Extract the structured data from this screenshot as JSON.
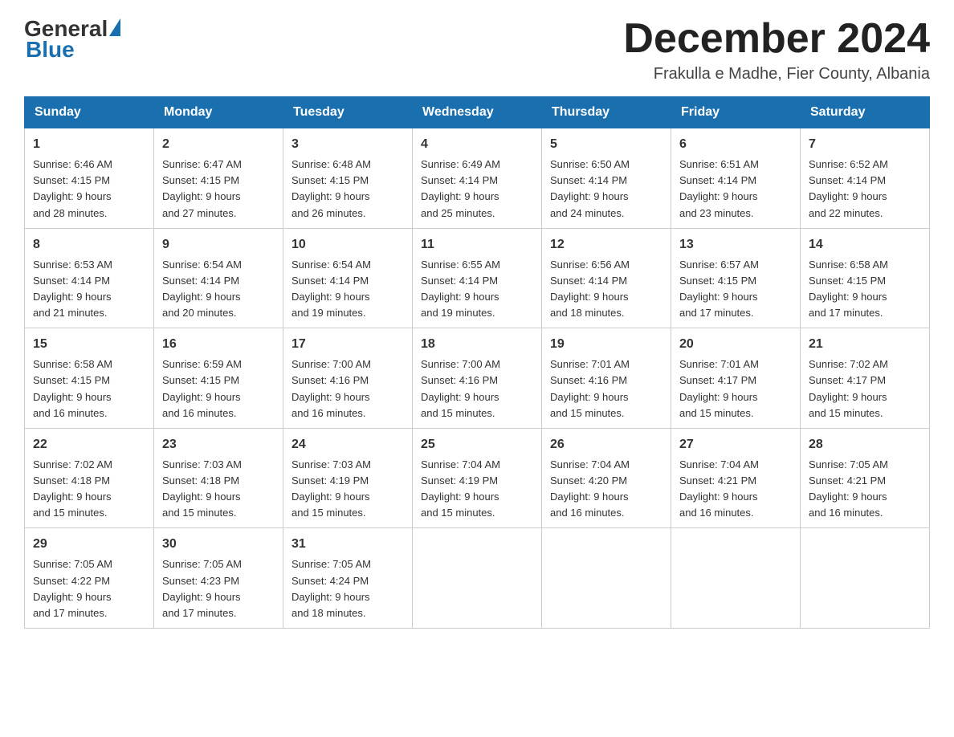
{
  "header": {
    "logo": {
      "general": "General",
      "blue": "Blue"
    },
    "title": "December 2024",
    "location": "Frakulla e Madhe, Fier County, Albania"
  },
  "days_of_week": [
    "Sunday",
    "Monday",
    "Tuesday",
    "Wednesday",
    "Thursday",
    "Friday",
    "Saturday"
  ],
  "weeks": [
    [
      {
        "day": "1",
        "sunrise": "6:46 AM",
        "sunset": "4:15 PM",
        "daylight": "9 hours and 28 minutes."
      },
      {
        "day": "2",
        "sunrise": "6:47 AM",
        "sunset": "4:15 PM",
        "daylight": "9 hours and 27 minutes."
      },
      {
        "day": "3",
        "sunrise": "6:48 AM",
        "sunset": "4:15 PM",
        "daylight": "9 hours and 26 minutes."
      },
      {
        "day": "4",
        "sunrise": "6:49 AM",
        "sunset": "4:14 PM",
        "daylight": "9 hours and 25 minutes."
      },
      {
        "day": "5",
        "sunrise": "6:50 AM",
        "sunset": "4:14 PM",
        "daylight": "9 hours and 24 minutes."
      },
      {
        "day": "6",
        "sunrise": "6:51 AM",
        "sunset": "4:14 PM",
        "daylight": "9 hours and 23 minutes."
      },
      {
        "day": "7",
        "sunrise": "6:52 AM",
        "sunset": "4:14 PM",
        "daylight": "9 hours and 22 minutes."
      }
    ],
    [
      {
        "day": "8",
        "sunrise": "6:53 AM",
        "sunset": "4:14 PM",
        "daylight": "9 hours and 21 minutes."
      },
      {
        "day": "9",
        "sunrise": "6:54 AM",
        "sunset": "4:14 PM",
        "daylight": "9 hours and 20 minutes."
      },
      {
        "day": "10",
        "sunrise": "6:54 AM",
        "sunset": "4:14 PM",
        "daylight": "9 hours and 19 minutes."
      },
      {
        "day": "11",
        "sunrise": "6:55 AM",
        "sunset": "4:14 PM",
        "daylight": "9 hours and 19 minutes."
      },
      {
        "day": "12",
        "sunrise": "6:56 AM",
        "sunset": "4:14 PM",
        "daylight": "9 hours and 18 minutes."
      },
      {
        "day": "13",
        "sunrise": "6:57 AM",
        "sunset": "4:15 PM",
        "daylight": "9 hours and 17 minutes."
      },
      {
        "day": "14",
        "sunrise": "6:58 AM",
        "sunset": "4:15 PM",
        "daylight": "9 hours and 17 minutes."
      }
    ],
    [
      {
        "day": "15",
        "sunrise": "6:58 AM",
        "sunset": "4:15 PM",
        "daylight": "9 hours and 16 minutes."
      },
      {
        "day": "16",
        "sunrise": "6:59 AM",
        "sunset": "4:15 PM",
        "daylight": "9 hours and 16 minutes."
      },
      {
        "day": "17",
        "sunrise": "7:00 AM",
        "sunset": "4:16 PM",
        "daylight": "9 hours and 16 minutes."
      },
      {
        "day": "18",
        "sunrise": "7:00 AM",
        "sunset": "4:16 PM",
        "daylight": "9 hours and 15 minutes."
      },
      {
        "day": "19",
        "sunrise": "7:01 AM",
        "sunset": "4:16 PM",
        "daylight": "9 hours and 15 minutes."
      },
      {
        "day": "20",
        "sunrise": "7:01 AM",
        "sunset": "4:17 PM",
        "daylight": "9 hours and 15 minutes."
      },
      {
        "day": "21",
        "sunrise": "7:02 AM",
        "sunset": "4:17 PM",
        "daylight": "9 hours and 15 minutes."
      }
    ],
    [
      {
        "day": "22",
        "sunrise": "7:02 AM",
        "sunset": "4:18 PM",
        "daylight": "9 hours and 15 minutes."
      },
      {
        "day": "23",
        "sunrise": "7:03 AM",
        "sunset": "4:18 PM",
        "daylight": "9 hours and 15 minutes."
      },
      {
        "day": "24",
        "sunrise": "7:03 AM",
        "sunset": "4:19 PM",
        "daylight": "9 hours and 15 minutes."
      },
      {
        "day": "25",
        "sunrise": "7:04 AM",
        "sunset": "4:19 PM",
        "daylight": "9 hours and 15 minutes."
      },
      {
        "day": "26",
        "sunrise": "7:04 AM",
        "sunset": "4:20 PM",
        "daylight": "9 hours and 16 minutes."
      },
      {
        "day": "27",
        "sunrise": "7:04 AM",
        "sunset": "4:21 PM",
        "daylight": "9 hours and 16 minutes."
      },
      {
        "day": "28",
        "sunrise": "7:05 AM",
        "sunset": "4:21 PM",
        "daylight": "9 hours and 16 minutes."
      }
    ],
    [
      {
        "day": "29",
        "sunrise": "7:05 AM",
        "sunset": "4:22 PM",
        "daylight": "9 hours and 17 minutes."
      },
      {
        "day": "30",
        "sunrise": "7:05 AM",
        "sunset": "4:23 PM",
        "daylight": "9 hours and 17 minutes."
      },
      {
        "day": "31",
        "sunrise": "7:05 AM",
        "sunset": "4:24 PM",
        "daylight": "9 hours and 18 minutes."
      },
      null,
      null,
      null,
      null
    ]
  ],
  "labels": {
    "sunrise": "Sunrise:",
    "sunset": "Sunset:",
    "daylight": "Daylight:"
  },
  "colors": {
    "header_bg": "#1a6faf",
    "accent": "#1a6faf"
  }
}
